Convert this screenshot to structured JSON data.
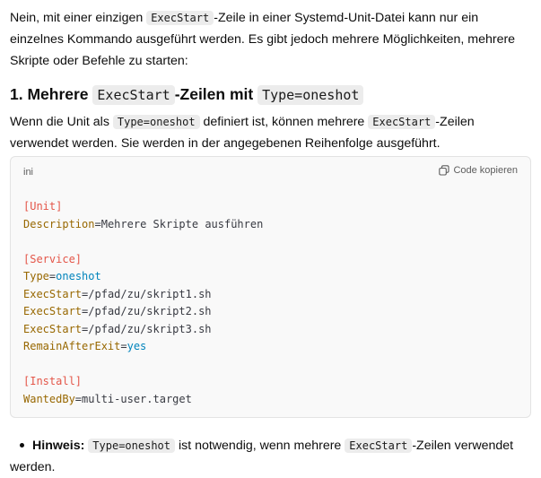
{
  "intro": {
    "t1": "Nein, mit einer einzigen ",
    "c1": "ExecStart",
    "t2": "-Zeile in einer Systemd-Unit-Datei kann nur ein einzelnes Kommando ausgeführt werden. Es gibt jedoch mehrere Möglichkeiten, mehrere Skripte oder Befehle zu starten:"
  },
  "heading": {
    "t1": "1. Mehrere ",
    "c1": "ExecStart",
    "t2": "-Zeilen mit ",
    "c2": "Type=oneshot"
  },
  "para": {
    "t1": "Wenn die Unit als ",
    "c1": "Type=oneshot",
    "t2": " definiert ist, können mehrere ",
    "c2": "ExecStart",
    "t3": "-Zeilen verwendet werden. Sie werden in der angegebenen Reihenfolge ausgeführt."
  },
  "code": {
    "language": "ini",
    "copy_label": "Code kopieren",
    "lines": {
      "l1": "[Unit]",
      "l2k": "Description",
      "l2v": "Mehrere Skripte ausführen",
      "l4": "[Service]",
      "l5k": "Type",
      "l5v": "oneshot",
      "l6k": "ExecStart",
      "l6v": "/pfad/zu/skript1.sh",
      "l7k": "ExecStart",
      "l7v": "/pfad/zu/skript2.sh",
      "l8k": "ExecStart",
      "l8v": "/pfad/zu/skript3.sh",
      "l9k": "RemainAfterExit",
      "l9v": "yes",
      "l11": "[Install]",
      "l12k": "WantedBy",
      "l12v": "multi-user.target"
    }
  },
  "hint": {
    "label": "Hinweis:",
    "c1": "Type=oneshot",
    "t1": " ist notwendig, wenn mehrere ",
    "c2": "ExecStart",
    "t2": "-Zeilen verwendet werden."
  }
}
